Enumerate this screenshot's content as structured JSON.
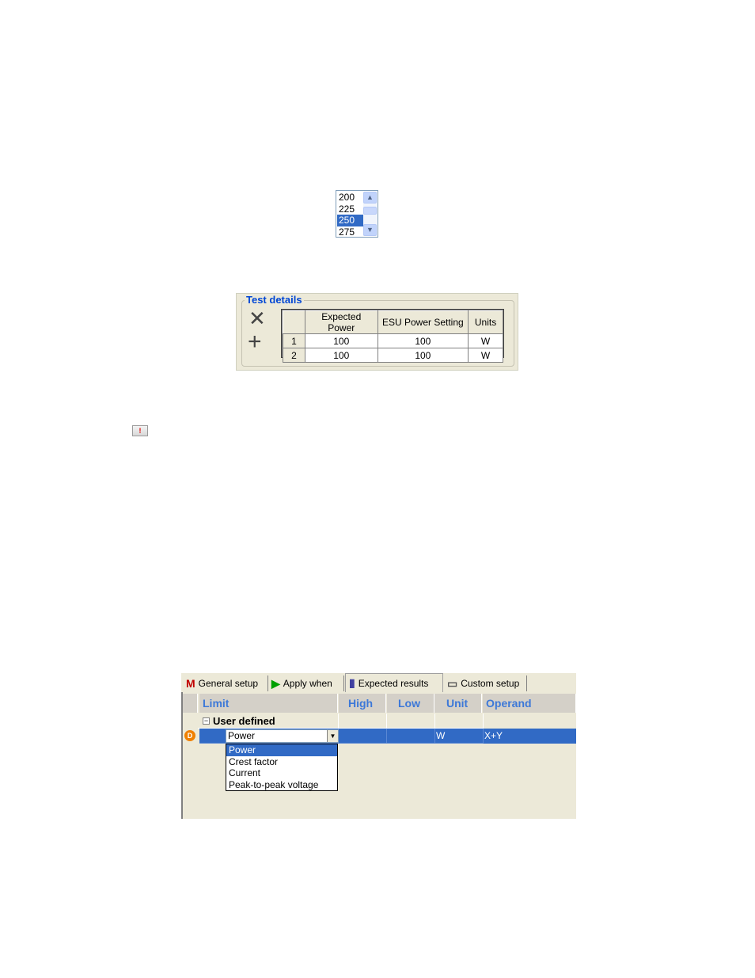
{
  "listbox": {
    "items": [
      "200",
      "225",
      "250",
      "275"
    ],
    "selected_index": 2
  },
  "test_details": {
    "title": "Test details",
    "columns": [
      "Expected Power",
      "ESU Power Setting",
      "Units"
    ],
    "rows": [
      {
        "num": "1",
        "expected_power": "100",
        "esu_power_setting": "100",
        "units": "W"
      },
      {
        "num": "2",
        "expected_power": "100",
        "esu_power_setting": "100",
        "units": "W"
      }
    ]
  },
  "warning_icon": {
    "glyph": "!"
  },
  "results": {
    "tabs": [
      {
        "label": "General setup",
        "icon": "m-logo-icon",
        "glyph": "M"
      },
      {
        "label": "Apply when",
        "icon": "play-icon",
        "glyph": "▶"
      },
      {
        "label": "Expected results",
        "icon": "bar-chart-icon",
        "glyph": "▮"
      },
      {
        "label": "Custom setup",
        "icon": "device-icon",
        "glyph": "▭"
      }
    ],
    "active_tab": 2,
    "columns": [
      "Limit",
      "High",
      "Low",
      "Unit",
      "Operand"
    ],
    "group": {
      "label": "User defined",
      "expander": "−"
    },
    "row": {
      "marker": "D",
      "limit": "Power",
      "high": "",
      "low": "",
      "unit": "W",
      "operand": "X+Y"
    },
    "dropdown": {
      "options": [
        "Power",
        "Crest factor",
        "Current",
        "Peak-to-peak voltage"
      ],
      "selected_index": 0
    }
  },
  "colors": {
    "selection": "#316ac5",
    "header_text": "#3c78d8",
    "group_title": "#0046d5"
  }
}
